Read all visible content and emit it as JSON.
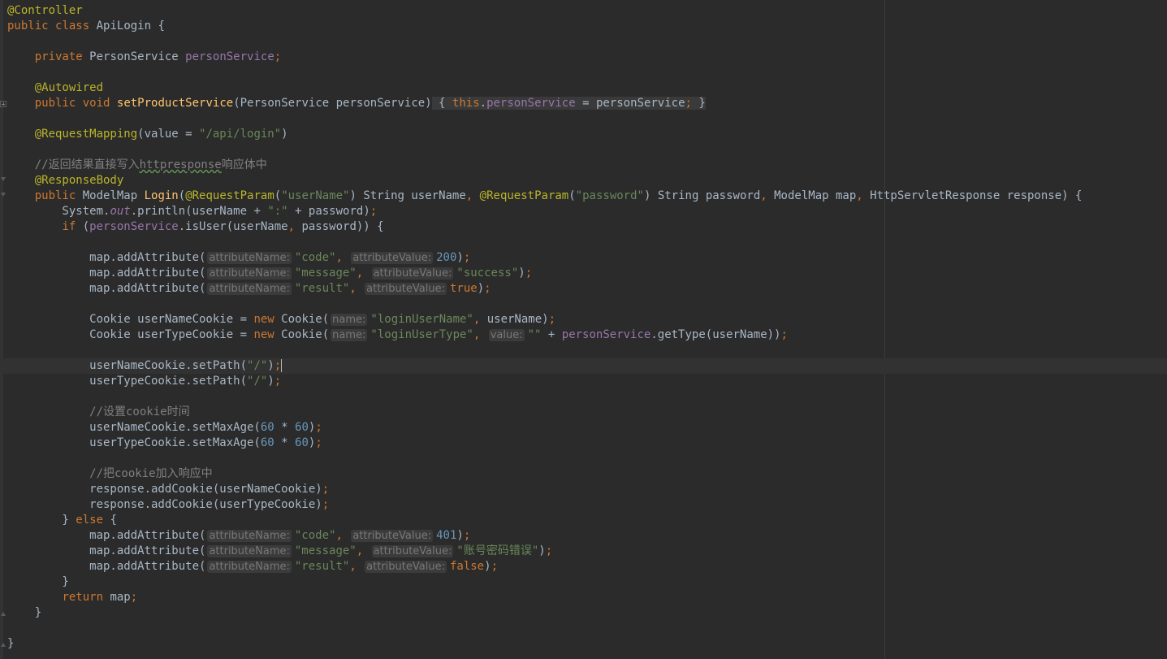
{
  "lines": {
    "l1": {
      "a": "@Controller"
    },
    "l2": {
      "a": "public",
      "b": " ",
      "c": "class",
      "d": " ApiLogin {"
    },
    "l4": {
      "a": "    ",
      "b": "private",
      "c": " PersonService ",
      "d": "personService",
      "e": ";"
    },
    "l6": {
      "a": "    ",
      "b": "@Autowired"
    },
    "l7": {
      "a": "    ",
      "b": "public",
      "c": " ",
      "d": "void",
      "e": " ",
      "f": "setProductService",
      "g": "(PersonService personService)",
      "h": " { ",
      "i": "this",
      "j": ".",
      "k": "personService",
      "l": " = personService",
      "m": ";",
      "n": " }"
    },
    "l9": {
      "a": "    ",
      "b": "@RequestMapping",
      "c": "(value = ",
      "d": "\"/api/login\"",
      "e": ")"
    },
    "l11": {
      "a": "    //返回结果直接写入",
      "b": "httpresponse",
      "c": "响应体中"
    },
    "l12": {
      "a": "    ",
      "b": "@ResponseBody"
    },
    "l13": {
      "a": "    ",
      "b": "public",
      "c": " ModelMap ",
      "d": "Login",
      "e": "(",
      "f": "@RequestParam",
      "g": "(",
      "h": "\"userName\"",
      "i": ") String userName",
      "j": ", ",
      "k": "@RequestParam",
      "l": "(",
      "m": "\"password\"",
      "n": ") String password",
      "o": ", ",
      "p": "ModelMap map",
      "q": ", ",
      "r": "HttpServletResponse response) {"
    },
    "l14": {
      "a": "        System.",
      "b": "out",
      "c": ".println(userName + ",
      "d": "\":\"",
      "e": " + password)",
      "f": ";"
    },
    "l15": {
      "a": "        ",
      "b": "if",
      "c": " (",
      "d": "personService",
      "e": ".isUser(userName",
      "f": ", ",
      "g": "password)) {"
    },
    "l17": {
      "a": "            map.addAttribute(",
      "b": "attributeName:",
      "c": "\"code\"",
      "d": ", ",
      "e": "attributeValue:",
      "f": "200",
      "g": ")",
      "h": ";"
    },
    "l18": {
      "a": "            map.addAttribute(",
      "b": "attributeName:",
      "c": "\"message\"",
      "d": ", ",
      "e": "attributeValue:",
      "f": "\"success\"",
      "g": ")",
      "h": ";"
    },
    "l19": {
      "a": "            map.addAttribute(",
      "b": "attributeName:",
      "c": "\"result\"",
      "d": ", ",
      "e": "attributeValue:",
      "f": "true",
      "g": ")",
      "h": ";"
    },
    "l21": {
      "a": "            Cookie userNameCookie = ",
      "b": "new",
      "c": " Cookie(",
      "d": "name:",
      "e": "\"loginUserName\"",
      "f": ", ",
      "g": "userName)",
      "h": ";"
    },
    "l22": {
      "a": "            Cookie userTypeCookie = ",
      "b": "new",
      "c": " Cookie(",
      "d": "name:",
      "e": "\"loginUserType\"",
      "f": ", ",
      "g": "value:",
      "h": "\"\"",
      "i": " + ",
      "j": "personService",
      "k": ".getType(userName))",
      "l": ";"
    },
    "l24": {
      "a": "            userNameCookie.setPath(",
      "b": "\"/\"",
      "c": ")",
      "d": ";"
    },
    "l25": {
      "a": "            userTypeCookie.setPath(",
      "b": "\"/\"",
      "c": ")",
      "d": ";"
    },
    "l27": {
      "a": "            //设置cookie时间"
    },
    "l28": {
      "a": "            userNameCookie.setMaxAge(",
      "b": "60",
      "c": " * ",
      "d": "60",
      "e": ")",
      "f": ";"
    },
    "l29": {
      "a": "            userTypeCookie.setMaxAge(",
      "b": "60",
      "c": " * ",
      "d": "60",
      "e": ")",
      "f": ";"
    },
    "l31": {
      "a": "            //把cookie加入响应中"
    },
    "l32": {
      "a": "            response.addCookie(userNameCookie)",
      "b": ";"
    },
    "l33": {
      "a": "            response.addCookie(userTypeCookie)",
      "b": ";"
    },
    "l34": {
      "a": "        } ",
      "b": "else",
      "c": " {"
    },
    "l35": {
      "a": "            map.addAttribute(",
      "b": "attributeName:",
      "c": "\"code\"",
      "d": ", ",
      "e": "attributeValue:",
      "f": "401",
      "g": ")",
      "h": ";"
    },
    "l36": {
      "a": "            map.addAttribute(",
      "b": "attributeName:",
      "c": "\"message\"",
      "d": ", ",
      "e": "attributeValue:",
      "f": "\"账号密码错误\"",
      "g": ")",
      "h": ";"
    },
    "l37": {
      "a": "            map.addAttribute(",
      "b": "attributeName:",
      "c": "\"result\"",
      "d": ", ",
      "e": "attributeValue:",
      "f": "false",
      "g": ")",
      "h": ";"
    },
    "l38": {
      "a": "        }"
    },
    "l39": {
      "a": "        ",
      "b": "return",
      "c": " map",
      "d": ";"
    },
    "l40": {
      "a": "    }"
    },
    "l42": {
      "a": "}"
    }
  },
  "colors": {
    "background": "#2b2b2b",
    "text": "#a9b7c6",
    "keyword": "#cc7832",
    "annotation": "#bbb529",
    "string": "#6a8759",
    "number": "#6897bb",
    "field": "#9876aa",
    "comment": "#808080",
    "method": "#ffc66d",
    "hint": "#787878"
  }
}
